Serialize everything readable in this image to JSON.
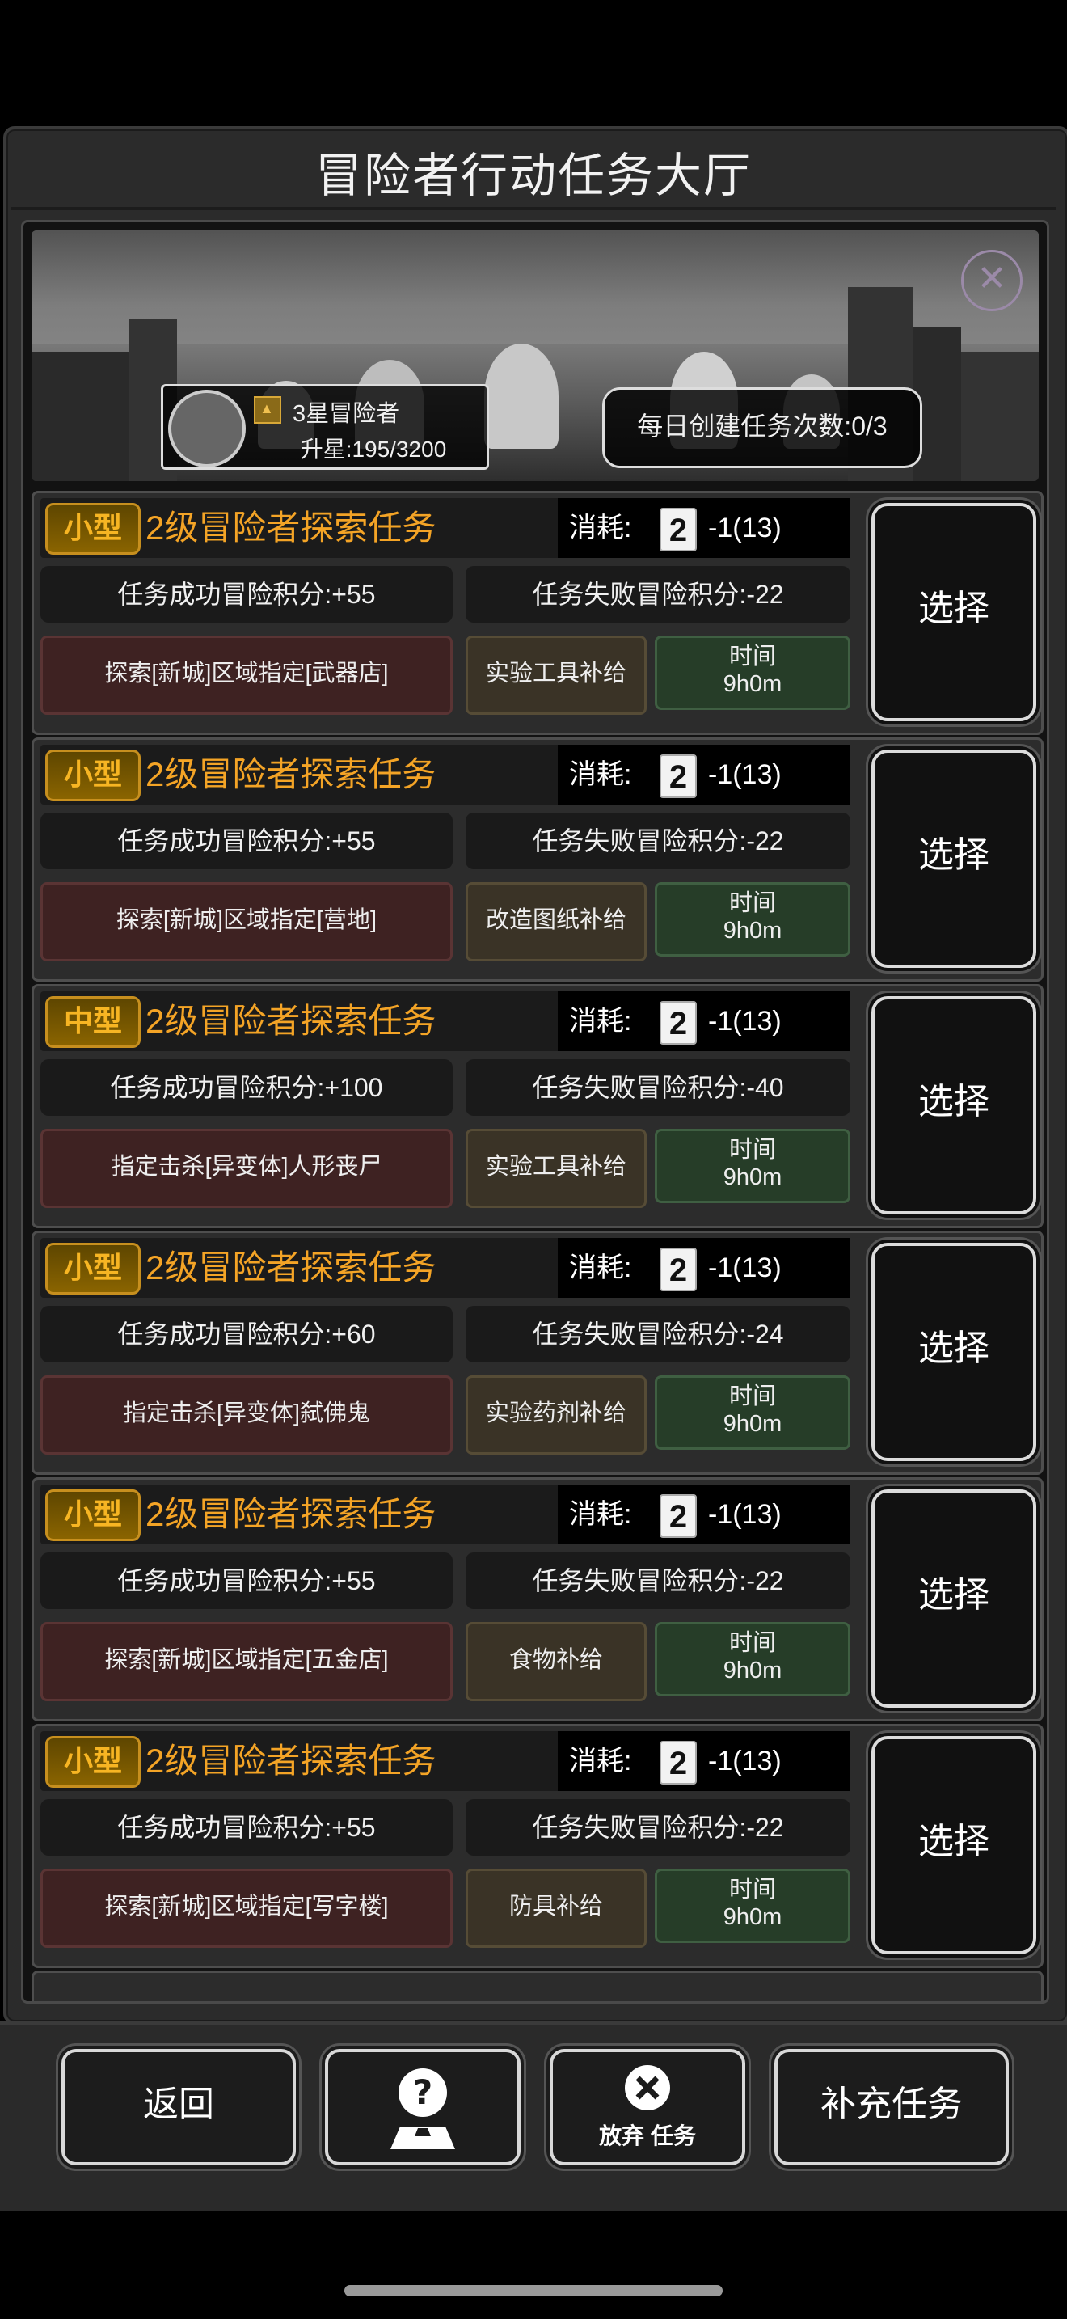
{
  "title": "冒险者行动任务大厅",
  "rank": {
    "label": "3星冒险者",
    "upgrade": "升星:195/3200"
  },
  "daily": "每日创建任务次数:0/3",
  "cost_label": "消耗:",
  "dice_value": "2",
  "select_label": "选择",
  "time_label": "时间",
  "tasks": [
    {
      "size": "小型",
      "title": "2级冒险者探索任务",
      "cost": "-1(13)",
      "success": "任务成功冒险积分:+55",
      "fail": "任务失败冒险积分:-22",
      "requirement": "探索[新城]区域指定[武器店]",
      "supply": "实验工具补给",
      "time": "9h0m"
    },
    {
      "size": "小型",
      "title": "2级冒险者探索任务",
      "cost": "-1(13)",
      "success": "任务成功冒险积分:+55",
      "fail": "任务失败冒险积分:-22",
      "requirement": "探索[新城]区域指定[营地]",
      "supply": "改造图纸补给",
      "time": "9h0m"
    },
    {
      "size": "中型",
      "title": "2级冒险者探索任务",
      "cost": "-1(13)",
      "success": "任务成功冒险积分:+100",
      "fail": "任务失败冒险积分:-40",
      "requirement": "指定击杀[异变体]人形丧尸",
      "supply": "实验工具补给",
      "time": "9h0m"
    },
    {
      "size": "小型",
      "title": "2级冒险者探索任务",
      "cost": "-1(13)",
      "success": "任务成功冒险积分:+60",
      "fail": "任务失败冒险积分:-24",
      "requirement": "指定击杀[异变体]弑佛鬼",
      "supply": "实验药剂补给",
      "time": "9h0m"
    },
    {
      "size": "小型",
      "title": "2级冒险者探索任务",
      "cost": "-1(13)",
      "success": "任务成功冒险积分:+55",
      "fail": "任务失败冒险积分:-22",
      "requirement": "探索[新城]区域指定[五金店]",
      "supply": "食物补给",
      "time": "9h0m"
    },
    {
      "size": "小型",
      "title": "2级冒险者探索任务",
      "cost": "-1(13)",
      "success": "任务成功冒险积分:+55",
      "fail": "任务失败冒险积分:-22",
      "requirement": "探索[新城]区域指定[写字楼]",
      "supply": "防具补给",
      "time": "9h0m"
    }
  ],
  "footer": {
    "back": "返回",
    "help_icon": "help-map-icon",
    "abandon": "放弃 任务",
    "refill": "补充任务"
  },
  "colors": {
    "accent": "#f4a426",
    "requirement_bg": "#3e2222",
    "time_bg": "#263d28"
  }
}
